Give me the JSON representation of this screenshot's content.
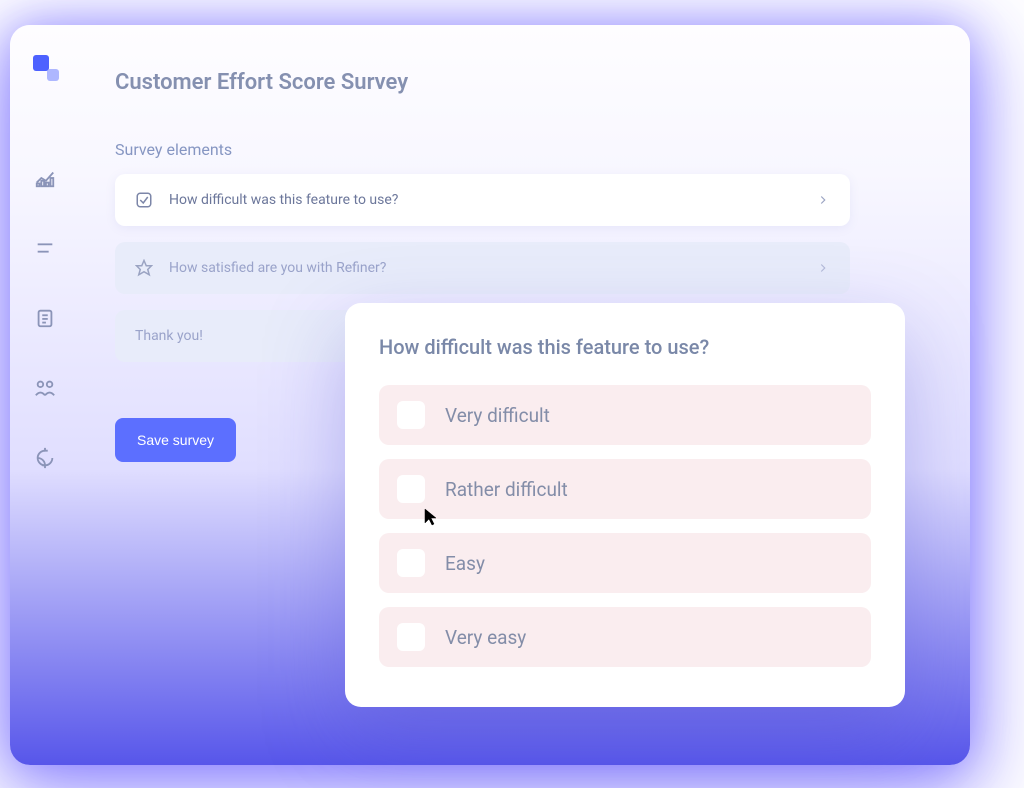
{
  "page": {
    "title": "Customer Effort Score Survey",
    "section_label": "Survey elements"
  },
  "sidebar": {
    "items": [
      {
        "name": "analytics-icon"
      },
      {
        "name": "menu-icon"
      },
      {
        "name": "clipboard-icon"
      },
      {
        "name": "people-icon"
      },
      {
        "name": "refresh-icon"
      }
    ]
  },
  "elements": [
    {
      "icon": "checkbox-icon",
      "label": "How difficult was this feature to use?",
      "style": "white"
    },
    {
      "icon": "star-icon",
      "label": "How satisfied are you with Refiner?",
      "style": "lavender"
    },
    {
      "icon": "",
      "label": "Thank you!",
      "style": "lavender"
    }
  ],
  "buttons": {
    "save": "Save survey"
  },
  "popup": {
    "title": "How difficult was this feature to use?",
    "options": [
      {
        "label": "Very difficult"
      },
      {
        "label": "Rather difficult"
      },
      {
        "label": "Easy"
      },
      {
        "label": "Very easy"
      }
    ]
  }
}
